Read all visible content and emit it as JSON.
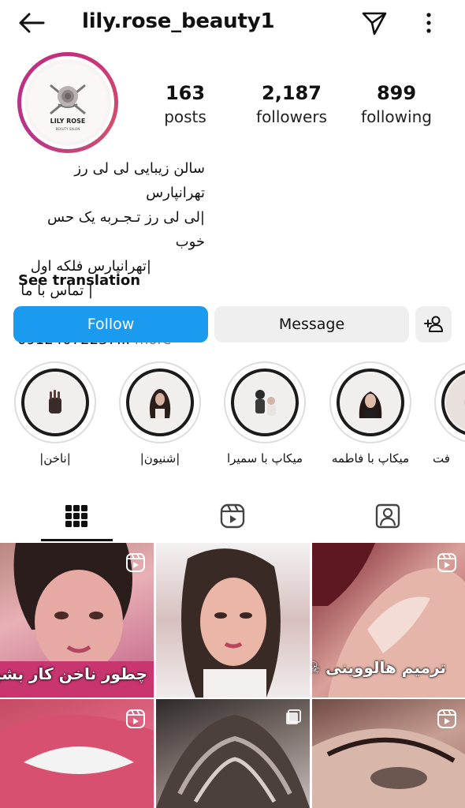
{
  "header": {
    "username": "lily.rose_beauty1"
  },
  "profile": {
    "logo_title": "LILY ROSE",
    "logo_subtitle": "BEAUTY SALON",
    "stats": {
      "posts_count": "163",
      "posts_label": "posts",
      "followers_count": "2,187",
      "followers_label": "followers",
      "following_count": "899",
      "following_label": "following"
    },
    "bio": {
      "line1": "سالن زیبایی لی لی رز تهرانپارس",
      "line2": "|لی لی رز تـجـربه یک حس خوب",
      "line3": "|تهرانپارس فلکه اول",
      "line4": "| تماس با ما |",
      "phone": "09124072237...",
      "more": " more"
    },
    "see_translation": "See translation"
  },
  "actions": {
    "follow": "Follow",
    "message": "Message"
  },
  "highlights": [
    {
      "label": "|ناخن|"
    },
    {
      "label": "|شنیون|"
    },
    {
      "label": "میکاپ با سمیرا"
    },
    {
      "label": "میکاپ با فاطمه"
    },
    {
      "label": "فت"
    }
  ],
  "grid": {
    "tile1_text": "چطور ناخن کار بشیم",
    "tile3_text": "ترمیم هالووینی ☠"
  },
  "colors": {
    "follow_button": "#1a9bf0",
    "secondary_button": "#efefef",
    "avatar_ring": "#c62d7a"
  },
  "icons": {
    "back": "arrow-left-icon",
    "send": "paper-plane-icon",
    "more": "vertical-dots-icon",
    "add_user": "add-user-icon",
    "grid_tab": "grid-icon",
    "reels_tab": "reels-icon",
    "tagged_tab": "tagged-user-icon"
  }
}
